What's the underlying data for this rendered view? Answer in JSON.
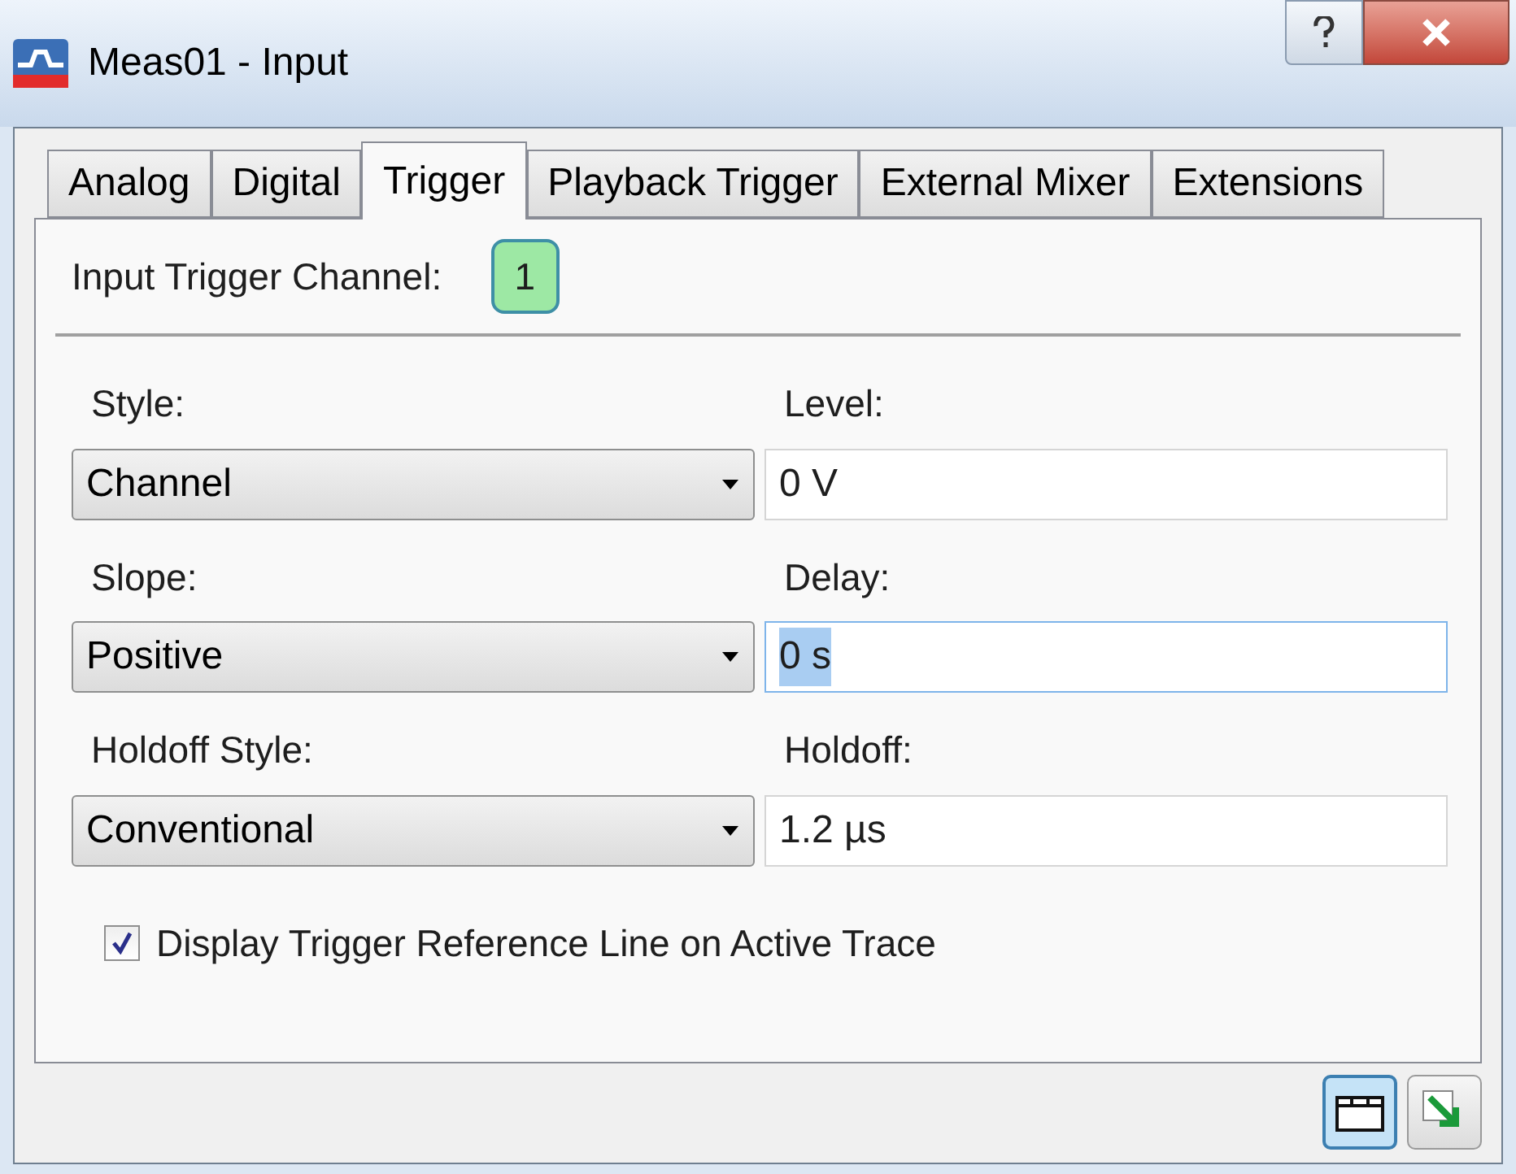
{
  "window": {
    "title": "Meas01 - Input"
  },
  "tabs": [
    {
      "label": "Analog",
      "selected": false
    },
    {
      "label": "Digital",
      "selected": false
    },
    {
      "label": "Trigger",
      "selected": true
    },
    {
      "label": "Playback Trigger",
      "selected": false
    },
    {
      "label": "External Mixer",
      "selected": false
    },
    {
      "label": "Extensions",
      "selected": false
    }
  ],
  "channel": {
    "label": "Input Trigger Channel:",
    "value": "1"
  },
  "rows": [
    {
      "left": {
        "label": "Style:",
        "value": "Channel"
      },
      "right": {
        "label": "Level:",
        "value": "0 V",
        "focused": false
      }
    },
    {
      "left": {
        "label": "Slope:",
        "value": "Positive"
      },
      "right": {
        "label": "Delay:",
        "value": "0 s",
        "focused": true
      }
    },
    {
      "left": {
        "label": "Holdoff Style:",
        "value": "Conventional"
      },
      "right": {
        "label": "Holdoff:",
        "value": "1.2 µs",
        "focused": false
      }
    }
  ],
  "checkbox": {
    "label": "Display Trigger Reference Line on Active Trace",
    "checked": true
  }
}
